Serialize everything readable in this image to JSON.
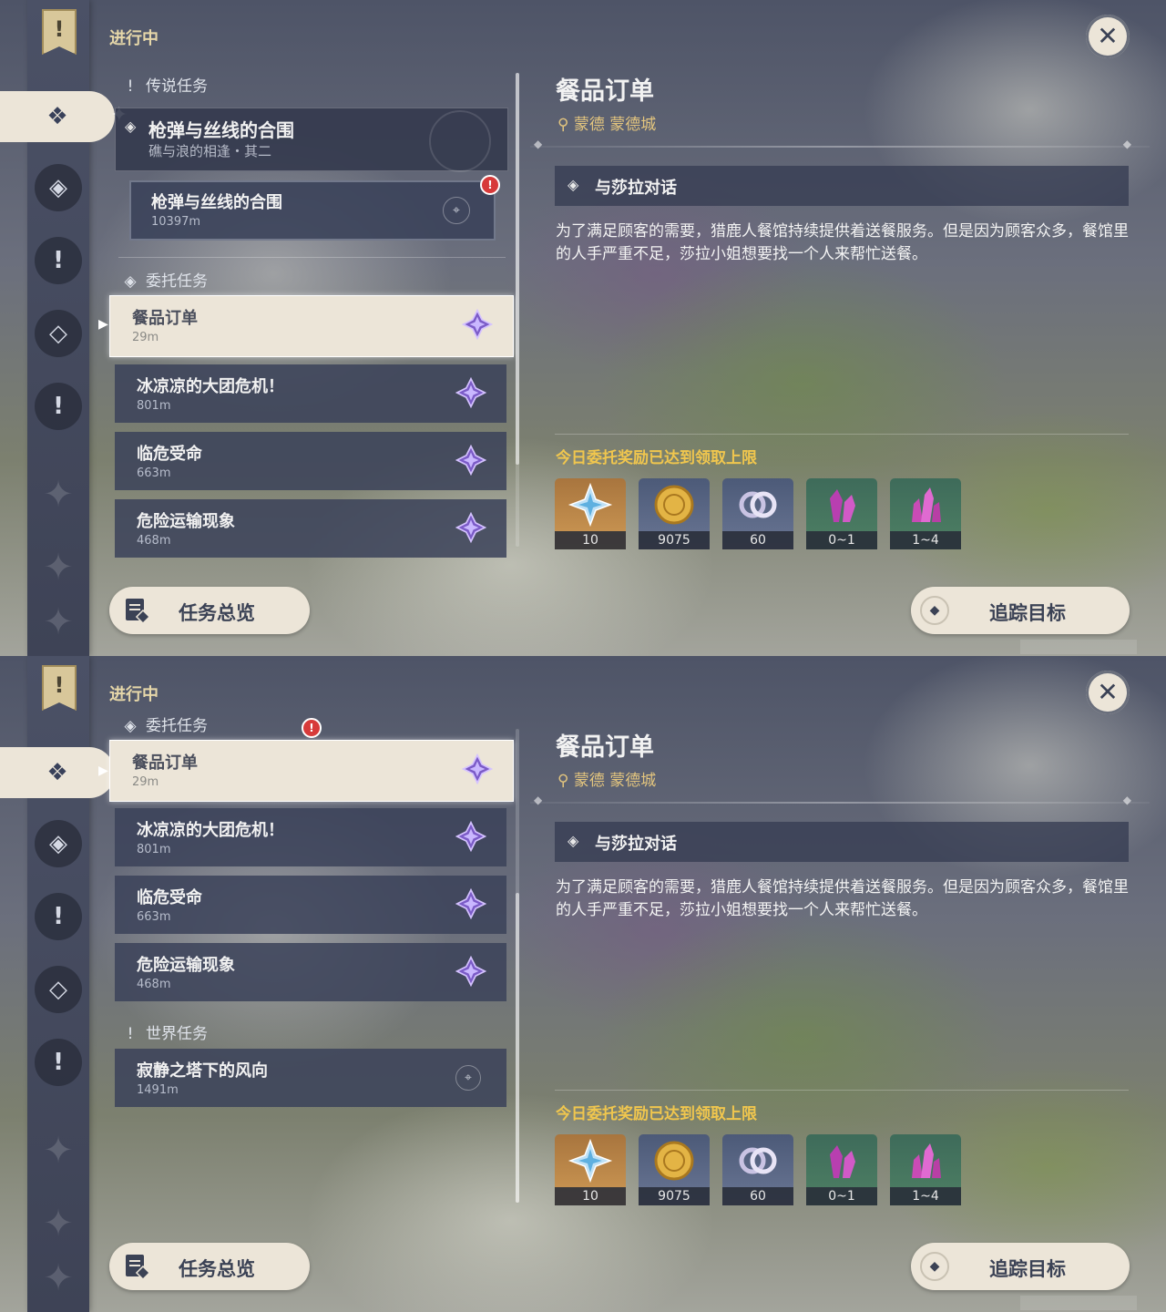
{
  "screens": [
    {
      "header": {
        "in_progress": "进行中"
      },
      "sections": {
        "legend": {
          "label": "传说任务",
          "title": "枪弹与丝线的合围",
          "subtitle": "礁与浪的相逢・其二",
          "sub_quest": {
            "title": "枪弹与丝线的合围",
            "distance": "10397m"
          }
        },
        "commission": {
          "label": "委托任务"
        }
      },
      "commissions": [
        {
          "title": "餐品订单",
          "distance": "29m"
        },
        {
          "title": "冰凉凉的大团危机！",
          "distance": "801m"
        },
        {
          "title": "临危受命",
          "distance": "663m"
        },
        {
          "title": "危险运输现象",
          "distance": "468m"
        }
      ],
      "detail": {
        "title": "餐品订单",
        "location": "蒙德 蒙德城",
        "objective": "与莎拉对话",
        "description": "为了满足顾客的需要，猎鹿人餐馆持续提供着送餐服务。但是因为顾客众多，餐馆里的人手严重不足，莎拉小姐想要找一个人来帮忙送餐。",
        "limit_notice": "今日委托奖励已达到领取上限",
        "rewards": [
          {
            "icon": "primogem-icon",
            "count": "10"
          },
          {
            "icon": "mora-icon",
            "count": "9075"
          },
          {
            "icon": "companionship-exp-icon",
            "count": "60"
          },
          {
            "icon": "mystic-crystal-icon",
            "count": "0~1"
          },
          {
            "icon": "adventure-crystal-icon",
            "count": "1~4"
          }
        ]
      },
      "buttons": {
        "overview": "任务总览",
        "track": "追踪目标"
      }
    },
    {
      "header": {
        "in_progress": "进行中"
      },
      "sections": {
        "commission": {
          "label": "委托任务"
        },
        "world": {
          "label": "世界任务",
          "quest": {
            "title": "寂静之塔下的风向",
            "distance": "1491m"
          }
        }
      },
      "commissions": [
        {
          "title": "餐品订单",
          "distance": "29m"
        },
        {
          "title": "冰凉凉的大团危机！",
          "distance": "801m"
        },
        {
          "title": "临危受命",
          "distance": "663m"
        },
        {
          "title": "危险运输现象",
          "distance": "468m"
        }
      ],
      "detail": {
        "title": "餐品订单",
        "location": "蒙德 蒙德城",
        "objective": "与莎拉对话",
        "description": "为了满足顾客的需要，猎鹿人餐馆持续提供着送餐服务。但是因为顾客众多，餐馆里的人手严重不足，莎拉小姐想要找一个人来帮忙送餐。",
        "limit_notice": "今日委托奖励已达到领取上限",
        "rewards": [
          {
            "icon": "primogem-icon",
            "count": "10"
          },
          {
            "icon": "mora-icon",
            "count": "9075"
          },
          {
            "icon": "companionship-exp-icon",
            "count": "60"
          },
          {
            "icon": "mystic-crystal-icon",
            "count": "0~1"
          },
          {
            "icon": "adventure-crystal-icon",
            "count": "1~4"
          }
        ]
      },
      "buttons": {
        "overview": "任务总览",
        "track": "追踪目标"
      }
    }
  ],
  "colors": {
    "accent_gold": "#e3c57e",
    "limit_text": "#f0c64e",
    "alert_red": "#d73a3a",
    "card_bg": "#3b425a",
    "active_card": "#ece5d8"
  }
}
